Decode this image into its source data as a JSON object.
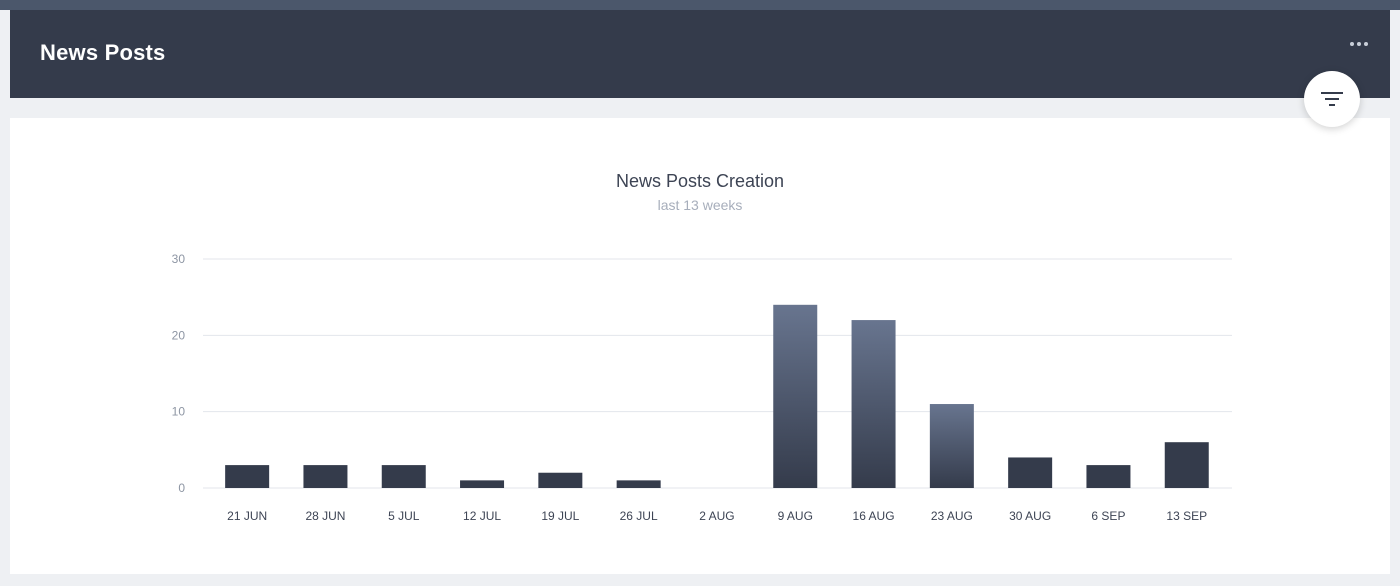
{
  "header": {
    "title": "News Posts",
    "more_icon": "more-horizontal-icon"
  },
  "filter_button": {
    "icon": "filter-icon"
  },
  "colors": {
    "header_bg": "#343b4b",
    "bar_dark": "#343b4b",
    "bar_light": "#68758f"
  },
  "chart_data": {
    "type": "bar",
    "title": "News Posts Creation",
    "subtitle": "last 13 weeks",
    "categories": [
      "21 JUN",
      "28 JUN",
      "5 JUL",
      "12 JUL",
      "19 JUL",
      "26 JUL",
      "2 AUG",
      "9 AUG",
      "16 AUG",
      "23 AUG",
      "30 AUG",
      "6 SEP",
      "13 SEP"
    ],
    "values": [
      3,
      3,
      3,
      1,
      2,
      1,
      0,
      24,
      22,
      11,
      4,
      3,
      6
    ],
    "ylim": [
      0,
      30
    ],
    "yticks": [
      0,
      10,
      20,
      30
    ],
    "grid": true
  }
}
